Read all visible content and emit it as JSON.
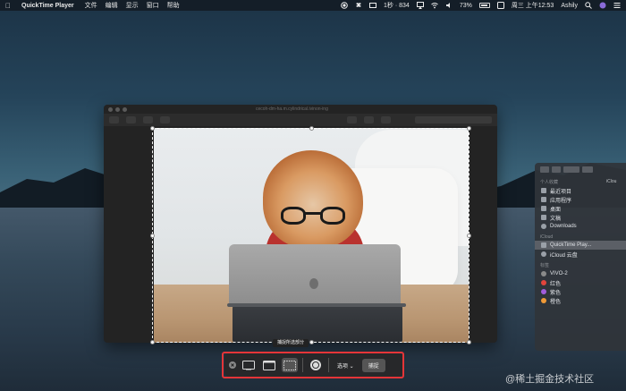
{
  "menubar": {
    "app_name": "QuickTime Player",
    "menus": [
      "文件",
      "编辑",
      "显示",
      "窗口",
      "帮助"
    ],
    "status_text": "1秒 · 834",
    "battery_pct": "73%",
    "time": "周三 上午12:53",
    "user": "Ashily"
  },
  "preview": {
    "title": "cecoh-dm-ha.m.cylindrical.ivinon-ing"
  },
  "selection": {
    "label": "捕捉所选部分"
  },
  "finder": {
    "favorites_header": "个人收藏",
    "favorites": [
      {
        "icon": "recents-icon",
        "label": "最近项目"
      },
      {
        "icon": "applications-icon",
        "label": "应用程序"
      },
      {
        "icon": "desktop-icon",
        "label": "桌面"
      },
      {
        "icon": "documents-icon",
        "label": "文稿"
      },
      {
        "icon": "downloads-icon",
        "label": "Downloads"
      }
    ],
    "icloud_header": "iCloud",
    "icloud": [
      {
        "icon": "folder-icon",
        "label": "QuickTime Play..."
      },
      {
        "icon": "icloud-drive-icon",
        "label": "iCloud 云盘"
      }
    ],
    "tags_header": "标签",
    "tags": [
      {
        "label": "VIVO-2",
        "color": "#8a8a8a"
      },
      {
        "label": "红色",
        "color": "#e2453c"
      },
      {
        "label": "紫色",
        "color": "#a25ddc"
      },
      {
        "label": "橙色",
        "color": "#f09a37"
      }
    ],
    "column_header": "iClou"
  },
  "screenshot_toolbar": {
    "options_label": "选项",
    "capture_label": "捕捉"
  },
  "watermark": "@稀土掘金技术社区",
  "colors": {
    "highlight_outline": "#e53538"
  }
}
